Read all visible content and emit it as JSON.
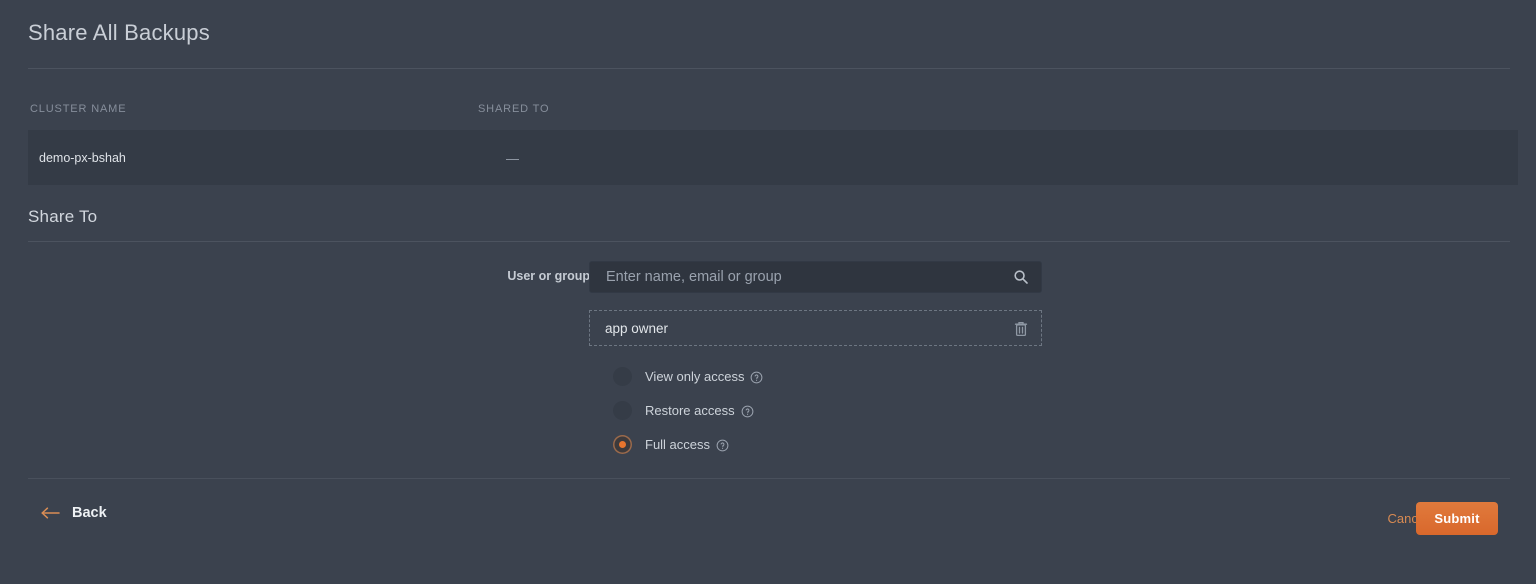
{
  "page": {
    "title": "Share All Backups"
  },
  "table": {
    "columns": [
      {
        "key": "cluster_name",
        "label": "CLUSTER NAME"
      },
      {
        "key": "shared_to",
        "label": "SHARED TO"
      }
    ],
    "rows": [
      {
        "cluster_name": "demo-px-bshah",
        "shared_to": "—"
      }
    ]
  },
  "share_to": {
    "section_title": "Share To",
    "field_label": "User or group",
    "search": {
      "value": "",
      "placeholder": "Enter name, email or group",
      "icon": "search-icon"
    },
    "selected_users": [
      {
        "name": "app owner",
        "delete_icon": "trash-icon"
      }
    ],
    "access_options": [
      {
        "label": "View only access",
        "selected": false,
        "help_icon": "help-circle-icon"
      },
      {
        "label": "Restore access",
        "selected": false,
        "help_icon": "help-circle-icon"
      },
      {
        "label": "Full access",
        "selected": true,
        "help_icon": "help-circle-icon"
      }
    ]
  },
  "footer": {
    "back_label": "Back",
    "back_icon": "arrow-left-icon",
    "cancel_label": "Cancel",
    "submit_label": "Submit"
  },
  "colors": {
    "page_background": "#3b424e",
    "row_background": "#343b46",
    "accent": "#e8752e",
    "accent_text": "#d88a52",
    "divider": "#4c535f",
    "text_primary": "#d7dbe0",
    "text_muted": "#868e9b"
  }
}
